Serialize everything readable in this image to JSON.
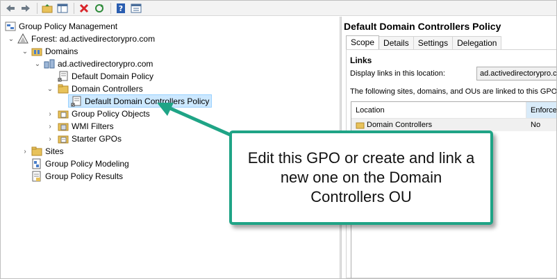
{
  "toolbar": {
    "buttons": [
      "back-icon",
      "forward-icon",
      "up-folder-icon",
      "show-hide-tree-icon",
      "delete-icon",
      "refresh-icon",
      "help-icon",
      "properties-icon"
    ]
  },
  "tree": {
    "root": "Group Policy Management",
    "forest": "Forest: ad.activedirectorypro.com",
    "domains": "Domains",
    "domain": "ad.activedirectorypro.com",
    "default_domain_policy": "Default Domain Policy",
    "domain_controllers": "Domain Controllers",
    "default_dc_policy": "Default Domain Controllers Policy",
    "gpo_objects": "Group Policy Objects",
    "wmi_filters": "WMI Filters",
    "starter_gpos": "Starter GPOs",
    "sites": "Sites",
    "modeling": "Group Policy Modeling",
    "results": "Group Policy Results"
  },
  "details": {
    "title": "Default Domain Controllers Policy",
    "tabs": [
      "Scope",
      "Details",
      "Settings",
      "Delegation"
    ],
    "links_heading": "Links",
    "display_label": "Display links in this location:",
    "display_value": "ad.activedirectorypro.co",
    "linked_label": "The following sites, domains, and OUs are linked to this GPO:",
    "columns": {
      "location": "Location",
      "enforced": "Enforced"
    },
    "rows": [
      {
        "location": "Domain Controllers",
        "enforced": "No"
      }
    ]
  },
  "callout": {
    "text": "Edit this GPO or create and link a new one on the Domain Controllers OU"
  },
  "colors": {
    "callout_border": "#1fa486",
    "selection": "#cce8ff"
  }
}
